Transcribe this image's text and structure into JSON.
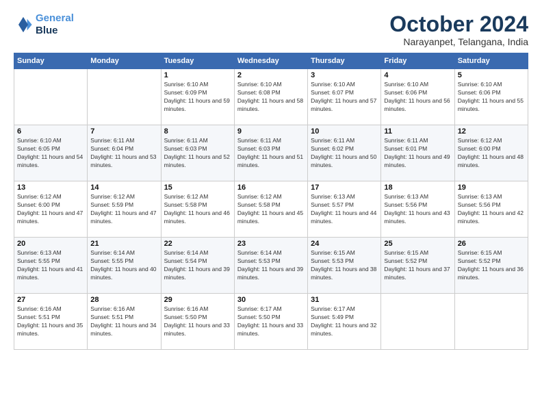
{
  "header": {
    "logo_line1": "General",
    "logo_line2": "Blue",
    "month": "October 2024",
    "location": "Narayanpet, Telangana, India"
  },
  "weekdays": [
    "Sunday",
    "Monday",
    "Tuesday",
    "Wednesday",
    "Thursday",
    "Friday",
    "Saturday"
  ],
  "weeks": [
    [
      {
        "day": "",
        "info": ""
      },
      {
        "day": "",
        "info": ""
      },
      {
        "day": "1",
        "info": "Sunrise: 6:10 AM\nSunset: 6:09 PM\nDaylight: 11 hours and 59 minutes."
      },
      {
        "day": "2",
        "info": "Sunrise: 6:10 AM\nSunset: 6:08 PM\nDaylight: 11 hours and 58 minutes."
      },
      {
        "day": "3",
        "info": "Sunrise: 6:10 AM\nSunset: 6:07 PM\nDaylight: 11 hours and 57 minutes."
      },
      {
        "day": "4",
        "info": "Sunrise: 6:10 AM\nSunset: 6:06 PM\nDaylight: 11 hours and 56 minutes."
      },
      {
        "day": "5",
        "info": "Sunrise: 6:10 AM\nSunset: 6:06 PM\nDaylight: 11 hours and 55 minutes."
      }
    ],
    [
      {
        "day": "6",
        "info": "Sunrise: 6:10 AM\nSunset: 6:05 PM\nDaylight: 11 hours and 54 minutes."
      },
      {
        "day": "7",
        "info": "Sunrise: 6:11 AM\nSunset: 6:04 PM\nDaylight: 11 hours and 53 minutes."
      },
      {
        "day": "8",
        "info": "Sunrise: 6:11 AM\nSunset: 6:03 PM\nDaylight: 11 hours and 52 minutes."
      },
      {
        "day": "9",
        "info": "Sunrise: 6:11 AM\nSunset: 6:03 PM\nDaylight: 11 hours and 51 minutes."
      },
      {
        "day": "10",
        "info": "Sunrise: 6:11 AM\nSunset: 6:02 PM\nDaylight: 11 hours and 50 minutes."
      },
      {
        "day": "11",
        "info": "Sunrise: 6:11 AM\nSunset: 6:01 PM\nDaylight: 11 hours and 49 minutes."
      },
      {
        "day": "12",
        "info": "Sunrise: 6:12 AM\nSunset: 6:00 PM\nDaylight: 11 hours and 48 minutes."
      }
    ],
    [
      {
        "day": "13",
        "info": "Sunrise: 6:12 AM\nSunset: 6:00 PM\nDaylight: 11 hours and 47 minutes."
      },
      {
        "day": "14",
        "info": "Sunrise: 6:12 AM\nSunset: 5:59 PM\nDaylight: 11 hours and 47 minutes."
      },
      {
        "day": "15",
        "info": "Sunrise: 6:12 AM\nSunset: 5:58 PM\nDaylight: 11 hours and 46 minutes."
      },
      {
        "day": "16",
        "info": "Sunrise: 6:12 AM\nSunset: 5:58 PM\nDaylight: 11 hours and 45 minutes."
      },
      {
        "day": "17",
        "info": "Sunrise: 6:13 AM\nSunset: 5:57 PM\nDaylight: 11 hours and 44 minutes."
      },
      {
        "day": "18",
        "info": "Sunrise: 6:13 AM\nSunset: 5:56 PM\nDaylight: 11 hours and 43 minutes."
      },
      {
        "day": "19",
        "info": "Sunrise: 6:13 AM\nSunset: 5:56 PM\nDaylight: 11 hours and 42 minutes."
      }
    ],
    [
      {
        "day": "20",
        "info": "Sunrise: 6:13 AM\nSunset: 5:55 PM\nDaylight: 11 hours and 41 minutes."
      },
      {
        "day": "21",
        "info": "Sunrise: 6:14 AM\nSunset: 5:55 PM\nDaylight: 11 hours and 40 minutes."
      },
      {
        "day": "22",
        "info": "Sunrise: 6:14 AM\nSunset: 5:54 PM\nDaylight: 11 hours and 39 minutes."
      },
      {
        "day": "23",
        "info": "Sunrise: 6:14 AM\nSunset: 5:53 PM\nDaylight: 11 hours and 39 minutes."
      },
      {
        "day": "24",
        "info": "Sunrise: 6:15 AM\nSunset: 5:53 PM\nDaylight: 11 hours and 38 minutes."
      },
      {
        "day": "25",
        "info": "Sunrise: 6:15 AM\nSunset: 5:52 PM\nDaylight: 11 hours and 37 minutes."
      },
      {
        "day": "26",
        "info": "Sunrise: 6:15 AM\nSunset: 5:52 PM\nDaylight: 11 hours and 36 minutes."
      }
    ],
    [
      {
        "day": "27",
        "info": "Sunrise: 6:16 AM\nSunset: 5:51 PM\nDaylight: 11 hours and 35 minutes."
      },
      {
        "day": "28",
        "info": "Sunrise: 6:16 AM\nSunset: 5:51 PM\nDaylight: 11 hours and 34 minutes."
      },
      {
        "day": "29",
        "info": "Sunrise: 6:16 AM\nSunset: 5:50 PM\nDaylight: 11 hours and 33 minutes."
      },
      {
        "day": "30",
        "info": "Sunrise: 6:17 AM\nSunset: 5:50 PM\nDaylight: 11 hours and 33 minutes."
      },
      {
        "day": "31",
        "info": "Sunrise: 6:17 AM\nSunset: 5:49 PM\nDaylight: 11 hours and 32 minutes."
      },
      {
        "day": "",
        "info": ""
      },
      {
        "day": "",
        "info": ""
      }
    ]
  ]
}
